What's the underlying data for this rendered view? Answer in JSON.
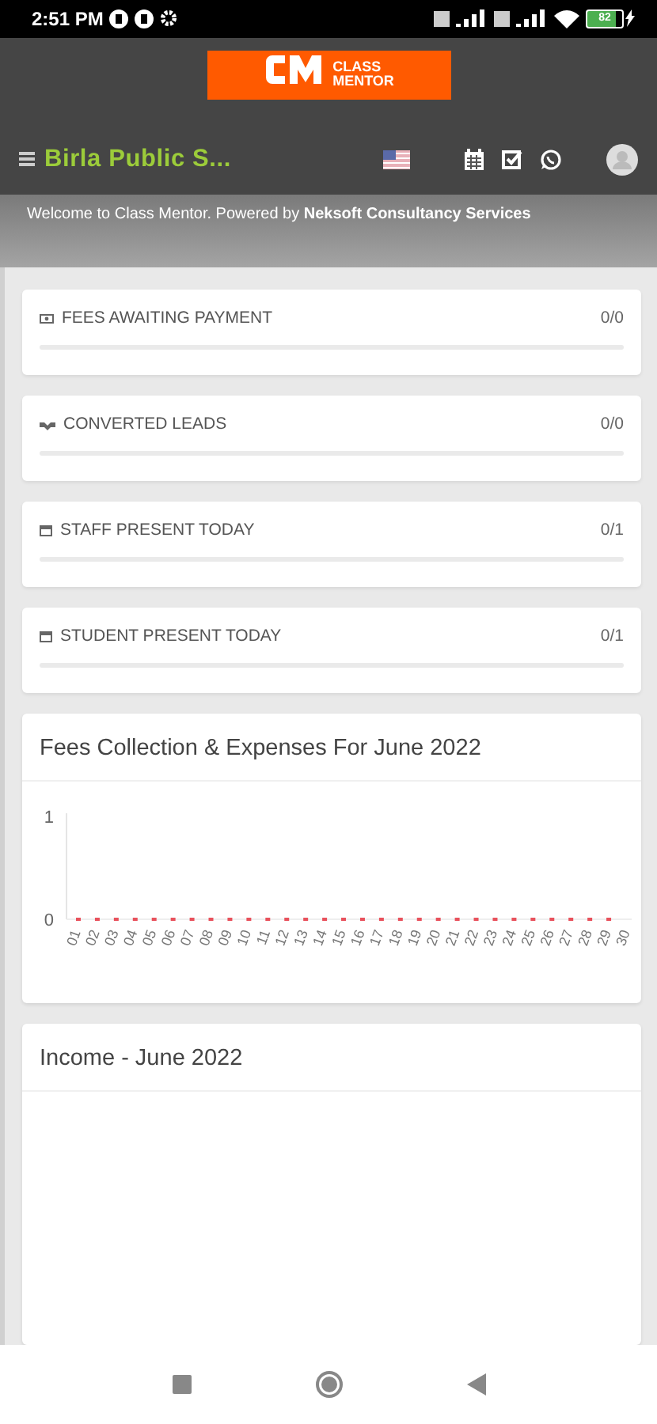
{
  "status_bar": {
    "time": "2:51 PM",
    "battery": "82"
  },
  "header": {
    "logo_line_1": "CLASS",
    "logo_line_2": "MENTOR",
    "school": "Birla Public S...",
    "welcome": "Welcome to Class Mentor. Powered by **Neksoft Consultancy Services**"
  },
  "stats": [
    {
      "kind": "fees",
      "label": "FEES AWAITING PAYMENT",
      "count": "0/0",
      "level": 0
    },
    {
      "kind": "leads",
      "label": "CONVERTED LEADS",
      "count": "0/0",
      "level": 0
    },
    {
      "kind": "staff",
      "label": "STAFF PRESENT TODAY",
      "count": "0/1",
      "level": 0
    },
    {
      "kind": "student",
      "label": "STUDENT PRESENT TODAY",
      "count": "0/1",
      "level": 0
    }
  ],
  "fees_chart": {
    "title": "Fees Collection & Expenses For June 2022",
    "chart_data": {
      "type": "line",
      "categories": [
        "01",
        "02",
        "03",
        "04",
        "05",
        "06",
        "07",
        "08",
        "09",
        "10",
        "11",
        "12",
        "13",
        "14",
        "15",
        "16",
        "17",
        "18",
        "19",
        "20",
        "21",
        "22",
        "23",
        "24",
        "25",
        "26",
        "27",
        "28",
        "29",
        "30"
      ],
      "series": [
        {
          "color": "#e8505b",
          "line_style": "dashed",
          "values": [
            0,
            0,
            0,
            0,
            0,
            0,
            0,
            0,
            0,
            0,
            0,
            0,
            0,
            0,
            0,
            0,
            0,
            0,
            0,
            0,
            0,
            0,
            0,
            0,
            0,
            0,
            0,
            0,
            0,
            0
          ]
        }
      ],
      "ylim": [
        0,
        1
      ],
      "yticks": [
        0,
        1
      ]
    }
  },
  "income_chart": {
    "title": "Income - June 2022"
  }
}
